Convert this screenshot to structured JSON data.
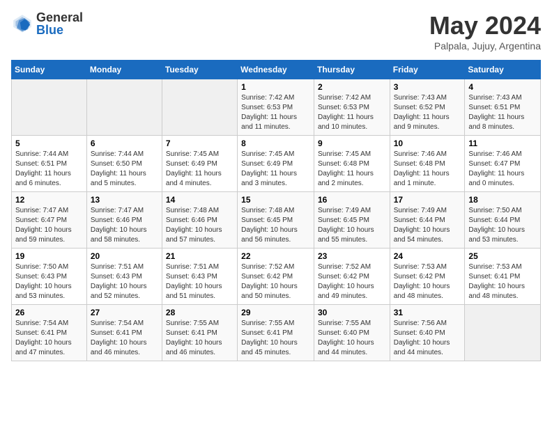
{
  "header": {
    "logo_general": "General",
    "logo_blue": "Blue",
    "month_title": "May 2024",
    "subtitle": "Palpala, Jujuy, Argentina"
  },
  "columns": [
    "Sunday",
    "Monday",
    "Tuesday",
    "Wednesday",
    "Thursday",
    "Friday",
    "Saturday"
  ],
  "weeks": [
    [
      {
        "day": "",
        "info": ""
      },
      {
        "day": "",
        "info": ""
      },
      {
        "day": "",
        "info": ""
      },
      {
        "day": "1",
        "info": "Sunrise: 7:42 AM\nSunset: 6:53 PM\nDaylight: 11 hours and 11 minutes."
      },
      {
        "day": "2",
        "info": "Sunrise: 7:42 AM\nSunset: 6:53 PM\nDaylight: 11 hours and 10 minutes."
      },
      {
        "day": "3",
        "info": "Sunrise: 7:43 AM\nSunset: 6:52 PM\nDaylight: 11 hours and 9 minutes."
      },
      {
        "day": "4",
        "info": "Sunrise: 7:43 AM\nSunset: 6:51 PM\nDaylight: 11 hours and 8 minutes."
      }
    ],
    [
      {
        "day": "5",
        "info": "Sunrise: 7:44 AM\nSunset: 6:51 PM\nDaylight: 11 hours and 6 minutes."
      },
      {
        "day": "6",
        "info": "Sunrise: 7:44 AM\nSunset: 6:50 PM\nDaylight: 11 hours and 5 minutes."
      },
      {
        "day": "7",
        "info": "Sunrise: 7:45 AM\nSunset: 6:49 PM\nDaylight: 11 hours and 4 minutes."
      },
      {
        "day": "8",
        "info": "Sunrise: 7:45 AM\nSunset: 6:49 PM\nDaylight: 11 hours and 3 minutes."
      },
      {
        "day": "9",
        "info": "Sunrise: 7:45 AM\nSunset: 6:48 PM\nDaylight: 11 hours and 2 minutes."
      },
      {
        "day": "10",
        "info": "Sunrise: 7:46 AM\nSunset: 6:48 PM\nDaylight: 11 hours and 1 minute."
      },
      {
        "day": "11",
        "info": "Sunrise: 7:46 AM\nSunset: 6:47 PM\nDaylight: 11 hours and 0 minutes."
      }
    ],
    [
      {
        "day": "12",
        "info": "Sunrise: 7:47 AM\nSunset: 6:47 PM\nDaylight: 10 hours and 59 minutes."
      },
      {
        "day": "13",
        "info": "Sunrise: 7:47 AM\nSunset: 6:46 PM\nDaylight: 10 hours and 58 minutes."
      },
      {
        "day": "14",
        "info": "Sunrise: 7:48 AM\nSunset: 6:46 PM\nDaylight: 10 hours and 57 minutes."
      },
      {
        "day": "15",
        "info": "Sunrise: 7:48 AM\nSunset: 6:45 PM\nDaylight: 10 hours and 56 minutes."
      },
      {
        "day": "16",
        "info": "Sunrise: 7:49 AM\nSunset: 6:45 PM\nDaylight: 10 hours and 55 minutes."
      },
      {
        "day": "17",
        "info": "Sunrise: 7:49 AM\nSunset: 6:44 PM\nDaylight: 10 hours and 54 minutes."
      },
      {
        "day": "18",
        "info": "Sunrise: 7:50 AM\nSunset: 6:44 PM\nDaylight: 10 hours and 53 minutes."
      }
    ],
    [
      {
        "day": "19",
        "info": "Sunrise: 7:50 AM\nSunset: 6:43 PM\nDaylight: 10 hours and 53 minutes."
      },
      {
        "day": "20",
        "info": "Sunrise: 7:51 AM\nSunset: 6:43 PM\nDaylight: 10 hours and 52 minutes."
      },
      {
        "day": "21",
        "info": "Sunrise: 7:51 AM\nSunset: 6:43 PM\nDaylight: 10 hours and 51 minutes."
      },
      {
        "day": "22",
        "info": "Sunrise: 7:52 AM\nSunset: 6:42 PM\nDaylight: 10 hours and 50 minutes."
      },
      {
        "day": "23",
        "info": "Sunrise: 7:52 AM\nSunset: 6:42 PM\nDaylight: 10 hours and 49 minutes."
      },
      {
        "day": "24",
        "info": "Sunrise: 7:53 AM\nSunset: 6:42 PM\nDaylight: 10 hours and 48 minutes."
      },
      {
        "day": "25",
        "info": "Sunrise: 7:53 AM\nSunset: 6:41 PM\nDaylight: 10 hours and 48 minutes."
      }
    ],
    [
      {
        "day": "26",
        "info": "Sunrise: 7:54 AM\nSunset: 6:41 PM\nDaylight: 10 hours and 47 minutes."
      },
      {
        "day": "27",
        "info": "Sunrise: 7:54 AM\nSunset: 6:41 PM\nDaylight: 10 hours and 46 minutes."
      },
      {
        "day": "28",
        "info": "Sunrise: 7:55 AM\nSunset: 6:41 PM\nDaylight: 10 hours and 46 minutes."
      },
      {
        "day": "29",
        "info": "Sunrise: 7:55 AM\nSunset: 6:41 PM\nDaylight: 10 hours and 45 minutes."
      },
      {
        "day": "30",
        "info": "Sunrise: 7:55 AM\nSunset: 6:40 PM\nDaylight: 10 hours and 44 minutes."
      },
      {
        "day": "31",
        "info": "Sunrise: 7:56 AM\nSunset: 6:40 PM\nDaylight: 10 hours and 44 minutes."
      },
      {
        "day": "",
        "info": ""
      }
    ]
  ]
}
